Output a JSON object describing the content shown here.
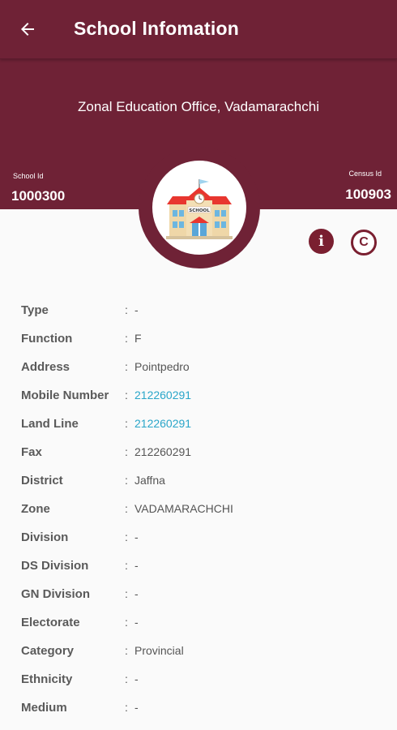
{
  "appbar": {
    "title": "School Infomation",
    "back_icon": "arrow-left-icon"
  },
  "header": {
    "zonal_office": "Zonal Education Office, Vadamarachchi",
    "school_id_label": "School Id",
    "school_id": "1000300",
    "census_id_label": "Census Id",
    "census_id": "100903"
  },
  "actions": {
    "info_icon": "info-icon",
    "info_glyph": "i",
    "copyright_icon": "copyright-icon",
    "copyright_glyph": "C"
  },
  "colors": {
    "primary": "#6f2236",
    "link": "#2aa6c9"
  },
  "details": [
    {
      "label": "Type",
      "value": "-"
    },
    {
      "label": "Function",
      "value": "F"
    },
    {
      "label": "Address",
      "value": "Pointpedro"
    },
    {
      "label": "Mobile Number",
      "value": "212260291"
    },
    {
      "label": "Land Line",
      "value": "212260291"
    },
    {
      "label": "Fax",
      "value": "212260291"
    },
    {
      "label": "District",
      "value": "Jaffna"
    },
    {
      "label": "Zone",
      "value": "VADAMARACHCHI"
    },
    {
      "label": "Division",
      "value": "-"
    },
    {
      "label": "DS Division",
      "value": "-"
    },
    {
      "label": "GN Division",
      "value": "-"
    },
    {
      "label": "Electorate",
      "value": "-"
    },
    {
      "label": "Category",
      "value": "Provincial"
    },
    {
      "label": "Ethnicity",
      "value": "-"
    },
    {
      "label": "Medium",
      "value": "-"
    }
  ],
  "colon": ":"
}
